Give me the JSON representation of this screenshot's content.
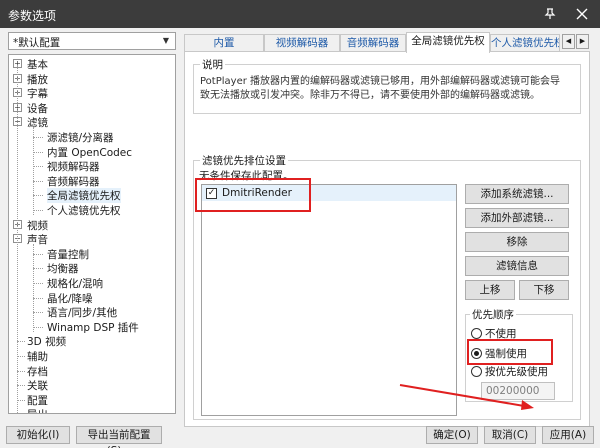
{
  "window": {
    "title": "参数选项",
    "pin_icon": "pin-icon",
    "close_icon": "close-icon"
  },
  "profile": {
    "selected": "*默认配置"
  },
  "tree": {
    "items": [
      {
        "label": "基本",
        "level": 0,
        "expander": "+"
      },
      {
        "label": "播放",
        "level": 0,
        "expander": "+"
      },
      {
        "label": "字幕",
        "level": 0,
        "expander": "+"
      },
      {
        "label": "设备",
        "level": 0,
        "expander": "+"
      },
      {
        "label": "滤镜",
        "level": 0,
        "expander": "-"
      },
      {
        "label": "源滤镜/分离器",
        "level": 1
      },
      {
        "label": "内置 OpenCodec",
        "level": 1
      },
      {
        "label": "视频解码器",
        "level": 1
      },
      {
        "label": "音频解码器",
        "level": 1
      },
      {
        "label": "全局滤镜优先权",
        "level": 1
      },
      {
        "label": "个人滤镜优先权",
        "level": 1
      },
      {
        "label": "视频",
        "level": 0,
        "expander": "+"
      },
      {
        "label": "声音",
        "level": 0,
        "expander": "-"
      },
      {
        "label": "音量控制",
        "level": 1
      },
      {
        "label": "均衡器",
        "level": 1
      },
      {
        "label": "规格化/混响",
        "level": 1
      },
      {
        "label": "晶化/降噪",
        "level": 1
      },
      {
        "label": "语言/同步/其他",
        "level": 1
      },
      {
        "label": "Winamp DSP 插件",
        "level": 1
      },
      {
        "label": "3D 视频",
        "level": 0
      },
      {
        "label": "辅助",
        "level": 0
      },
      {
        "label": "存档",
        "level": 0
      },
      {
        "label": "关联",
        "level": 0
      },
      {
        "label": "配置",
        "level": 0
      },
      {
        "label": "导出",
        "level": 0
      }
    ]
  },
  "tabs": [
    {
      "label": "内置 OpenCodec"
    },
    {
      "label": "视频解码器"
    },
    {
      "label": "音频解码器"
    },
    {
      "label": "全局滤镜优先权"
    },
    {
      "label": "个人滤镜优先权"
    }
  ],
  "description": {
    "title": "说明",
    "text1": "PotPlayer 播放器内置的编解码器或滤镜已够用，用外部编解码器或滤镜可能会导",
    "text2": "致无法播放或引发冲突。除非万不得已，请不要使用外部的编解码器或滤镜。"
  },
  "priority": {
    "title": "滤镜优先排位设置",
    "note": "无条件保存此配置。",
    "filters": [
      {
        "label": "DmitriRender",
        "checked": "✓"
      }
    ],
    "buttons": {
      "add_system": "添加系统滤镜...",
      "add_external": "添加外部滤镜...",
      "remove": "移除",
      "info": "滤镜信息",
      "up": "上移",
      "down": "下移"
    },
    "order": {
      "title": "优先顺序",
      "options": [
        "不使用",
        "强制使用",
        "按优先级使用"
      ],
      "selected": "强制使用",
      "merit_value": "00200000"
    }
  },
  "footer": {
    "init": "初始化(I)",
    "export": "导出当前配置(S)...",
    "ok": "确定(O)",
    "cancel": "取消(C)",
    "apply": "应用(A)"
  },
  "colors": {
    "titlebar": "#3c3c3c",
    "highlight": "#e02020",
    "annotation_arrow": "#e02020"
  }
}
